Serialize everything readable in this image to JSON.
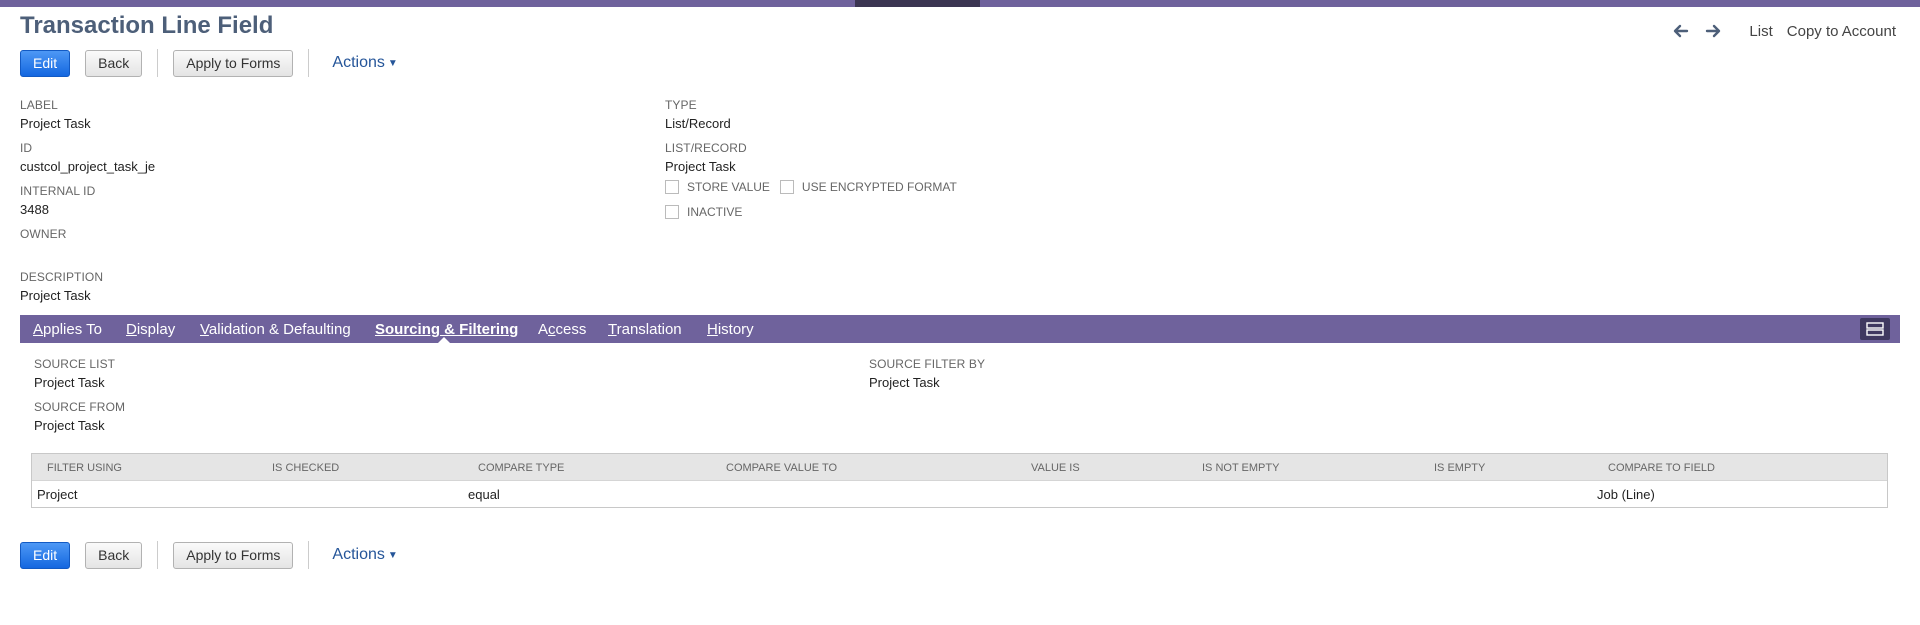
{
  "page": {
    "title": "Transaction Line Field"
  },
  "nav": {
    "list": "List",
    "copy": "Copy to Account",
    "prev_icon": "arrow-left-icon",
    "next_icon": "arrow-right-icon"
  },
  "buttons": {
    "edit": "Edit",
    "back": "Back",
    "apply": "Apply to Forms",
    "actions": "Actions"
  },
  "fields": {
    "label": {
      "label": "LABEL",
      "value": "Project Task"
    },
    "id": {
      "label": "ID",
      "value": "custcol_project_task_je"
    },
    "internal_id": {
      "label": "INTERNAL ID",
      "value": "3488"
    },
    "owner": {
      "label": "OWNER",
      "value": ""
    },
    "description": {
      "label": "DESCRIPTION",
      "value": "Project Task"
    },
    "type": {
      "label": "TYPE",
      "value": "List/Record"
    },
    "list_record": {
      "label": "LIST/RECORD",
      "value": "Project Task"
    }
  },
  "checkboxes": {
    "store_value": {
      "label": "STORE VALUE",
      "checked": false
    },
    "encrypted": {
      "label": "USE ENCRYPTED FORMAT",
      "checked": false
    },
    "inactive": {
      "label": "INACTIVE",
      "checked": false
    }
  },
  "tabs": [
    {
      "key": "A",
      "rest": "pplies To"
    },
    {
      "key": "D",
      "rest": "isplay"
    },
    {
      "key": "V",
      "rest": "alidation & Defaulting"
    },
    {
      "key": "S",
      "rest": "ourcing & Filtering"
    },
    {
      "key": "A",
      "rest": "ccess",
      "pre": "A",
      "post": "cess",
      "mid": "c"
    },
    {
      "key": "T",
      "rest": "ranslation"
    },
    {
      "key": "H",
      "rest": "istory"
    }
  ],
  "tab_labels": {
    "applies": [
      "A",
      "pplies To"
    ],
    "display": [
      "D",
      "isplay"
    ],
    "validation": [
      "V",
      "alidation & Defaulting"
    ],
    "sourcing": [
      "S",
      "ourcing & Filtering"
    ],
    "access_pre": "A",
    "access_key": "c",
    "access_post": "cess",
    "translation": [
      "T",
      "ranslation"
    ],
    "history": [
      "H",
      "istory"
    ]
  },
  "sourcing": {
    "source_list": {
      "label": "SOURCE LIST",
      "value": "Project Task"
    },
    "source_from": {
      "label": "SOURCE FROM",
      "value": "Project Task"
    },
    "source_filter_by": {
      "label": "SOURCE FILTER BY",
      "value": "Project Task"
    }
  },
  "filter_table": {
    "columns": [
      "FILTER USING",
      "IS CHECKED",
      "COMPARE TYPE",
      "COMPARE VALUE TO",
      "VALUE IS",
      "IS NOT EMPTY",
      "IS EMPTY",
      "COMPARE TO FIELD"
    ],
    "rows": [
      [
        "Project",
        "",
        "equal",
        "",
        "",
        "",
        "",
        "Job (Line)"
      ]
    ]
  },
  "colors": {
    "accent": "#6f629c",
    "primary_button": "#1467e0",
    "title": "#4d5f79",
    "link": "#255599"
  }
}
